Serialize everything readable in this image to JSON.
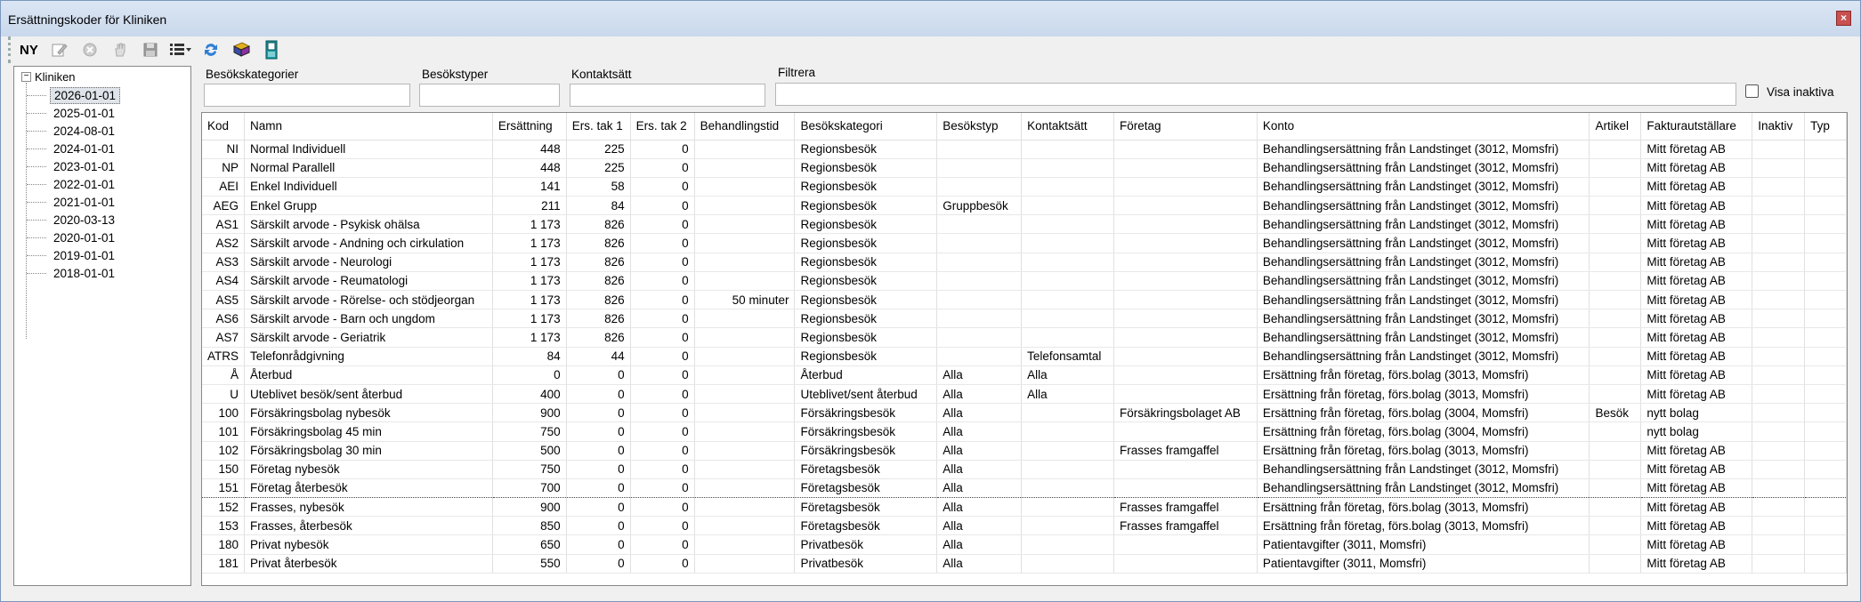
{
  "window": {
    "title": "Ersättningskoder för Kliniken",
    "close_label": "×"
  },
  "toolbar": {
    "new_label": "NY",
    "icons": [
      "edit-icon",
      "delete-icon",
      "hand-icon",
      "save-icon",
      "list-view-icon",
      "refresh-icon",
      "book-icon",
      "door-icon"
    ]
  },
  "tree": {
    "root": "Kliniken",
    "toggle": "−",
    "items": [
      "2026-01-01",
      "2025-01-01",
      "2024-08-01",
      "2024-01-01",
      "2023-01-01",
      "2022-01-01",
      "2021-01-01",
      "2020-03-13",
      "2020-01-01",
      "2019-01-01",
      "2018-01-01"
    ]
  },
  "filters": {
    "besokskategorier": "Besökskategorier",
    "besokstyper": "Besökstyper",
    "kontaktsatt": "Kontaktsätt",
    "filtrera": "Filtrera",
    "visa_inaktiva": "Visa inaktiva"
  },
  "columns": [
    "Kod",
    "Namn",
    "Ersättning",
    "Ers. tak 1",
    "Ers. tak 2",
    "Behandlingstid",
    "Besökskategori",
    "Besökstyp",
    "Kontaktsätt",
    "Företag",
    "Konto",
    "Artikel",
    "Fakturautställare",
    "Inaktiv",
    "Typ"
  ],
  "rows": [
    [
      "NI",
      "Normal Individuell",
      "448",
      "225",
      "0",
      "",
      "Regionsbesök",
      "",
      "",
      "",
      "Behandlingsersättning från Landstinget (3012, Momsfri)",
      "",
      "Mitt företag AB",
      "",
      ""
    ],
    [
      "NP",
      "Normal Parallell",
      "448",
      "225",
      "0",
      "",
      "Regionsbesök",
      "",
      "",
      "",
      "Behandlingsersättning från Landstinget (3012, Momsfri)",
      "",
      "Mitt företag AB",
      "",
      ""
    ],
    [
      "AEI",
      "Enkel Individuell",
      "141",
      "58",
      "0",
      "",
      "Regionsbesök",
      "",
      "",
      "",
      "Behandlingsersättning från Landstinget (3012, Momsfri)",
      "",
      "Mitt företag AB",
      "",
      ""
    ],
    [
      "AEG",
      "Enkel Grupp",
      "211",
      "84",
      "0",
      "",
      "Regionsbesök",
      "Gruppbesök",
      "",
      "",
      "Behandlingsersättning från Landstinget (3012, Momsfri)",
      "",
      "Mitt företag AB",
      "",
      ""
    ],
    [
      "AS1",
      "Särskilt arvode - Psykisk ohälsa",
      "1 173",
      "826",
      "0",
      "",
      "Regionsbesök",
      "",
      "",
      "",
      "Behandlingsersättning från Landstinget (3012, Momsfri)",
      "",
      "Mitt företag AB",
      "",
      ""
    ],
    [
      "AS2",
      "Särskilt arvode - Andning och cirkulation",
      "1 173",
      "826",
      "0",
      "",
      "Regionsbesök",
      "",
      "",
      "",
      "Behandlingsersättning från Landstinget (3012, Momsfri)",
      "",
      "Mitt företag AB",
      "",
      ""
    ],
    [
      "AS3",
      "Särskilt arvode - Neurologi",
      "1 173",
      "826",
      "0",
      "",
      "Regionsbesök",
      "",
      "",
      "",
      "Behandlingsersättning från Landstinget (3012, Momsfri)",
      "",
      "Mitt företag AB",
      "",
      ""
    ],
    [
      "AS4",
      "Särskilt arvode - Reumatologi",
      "1 173",
      "826",
      "0",
      "",
      "Regionsbesök",
      "",
      "",
      "",
      "Behandlingsersättning från Landstinget (3012, Momsfri)",
      "",
      "Mitt företag AB",
      "",
      ""
    ],
    [
      "AS5",
      "Särskilt arvode - Rörelse- och stödjeorgan",
      "1 173",
      "826",
      "0",
      "50 minuter",
      "Regionsbesök",
      "",
      "",
      "",
      "Behandlingsersättning från Landstinget (3012, Momsfri)",
      "",
      "Mitt företag AB",
      "",
      ""
    ],
    [
      "AS6",
      "Särskilt arvode - Barn och ungdom",
      "1 173",
      "826",
      "0",
      "",
      "Regionsbesök",
      "",
      "",
      "",
      "Behandlingsersättning från Landstinget (3012, Momsfri)",
      "",
      "Mitt företag AB",
      "",
      ""
    ],
    [
      "AS7",
      "Särskilt arvode - Geriatrik",
      "1 173",
      "826",
      "0",
      "",
      "Regionsbesök",
      "",
      "",
      "",
      "Behandlingsersättning från Landstinget (3012, Momsfri)",
      "",
      "Mitt företag AB",
      "",
      ""
    ],
    [
      "ATRS",
      "Telefonrådgivning",
      "84",
      "44",
      "0",
      "",
      "Regionsbesök",
      "",
      "Telefonsamtal",
      "",
      "Behandlingsersättning från Landstinget (3012, Momsfri)",
      "",
      "Mitt företag AB",
      "",
      ""
    ],
    [
      "Å",
      "Återbud",
      "0",
      "0",
      "0",
      "",
      "Återbud",
      "Alla",
      "Alla",
      "",
      "Ersättning från företag, förs.bolag (3013, Momsfri)",
      "",
      "Mitt företag AB",
      "",
      ""
    ],
    [
      "U",
      "Uteblivet besök/sent återbud",
      "400",
      "0",
      "0",
      "",
      "Uteblivet/sent återbud",
      "Alla",
      "Alla",
      "",
      "Ersättning från företag, förs.bolag (3013, Momsfri)",
      "",
      "Mitt företag AB",
      "",
      ""
    ],
    [
      "100",
      "Försäkringsbolag nybesök",
      "900",
      "0",
      "0",
      "",
      "Försäkringsbesök",
      "Alla",
      "",
      "Försäkringsbolaget AB",
      "Ersättning från företag, förs.bolag (3004, Momsfri)",
      "Besök",
      "nytt bolag",
      "",
      ""
    ],
    [
      "101",
      "Försäkringsbolag 45 min",
      "750",
      "0",
      "0",
      "",
      "Försäkringsbesök",
      "Alla",
      "",
      "",
      "Ersättning från företag, förs.bolag (3004, Momsfri)",
      "",
      "nytt bolag",
      "",
      ""
    ],
    [
      "102",
      "Försäkringsbolag 30 min",
      "500",
      "0",
      "0",
      "",
      "Försäkringsbesök",
      "Alla",
      "",
      "Frasses framgaffel",
      "Ersättning från företag, förs.bolag (3013, Momsfri)",
      "",
      "Mitt företag AB",
      "",
      ""
    ],
    [
      "150",
      "Företag nybesök",
      "750",
      "0",
      "0",
      "",
      "Företagsbesök",
      "Alla",
      "",
      "",
      "Behandlingsersättning från Landstinget (3012, Momsfri)",
      "",
      "Mitt företag AB",
      "",
      ""
    ],
    [
      "151",
      "Företag återbesök",
      "700",
      "0",
      "0",
      "",
      "Företagsbesök",
      "Alla",
      "",
      "",
      "Behandlingsersättning från Landstinget (3012, Momsfri)",
      "",
      "Mitt företag AB",
      "",
      ""
    ],
    [
      "152",
      "Frasses, nybesök",
      "900",
      "0",
      "0",
      "",
      "Företagsbesök",
      "Alla",
      "",
      "Frasses framgaffel",
      "Ersättning från företag, förs.bolag (3013, Momsfri)",
      "",
      "Mitt företag AB",
      "",
      ""
    ],
    [
      "153",
      "Frasses, återbesök",
      "850",
      "0",
      "0",
      "",
      "Företagsbesök",
      "Alla",
      "",
      "Frasses framgaffel",
      "Ersättning från företag, förs.bolag (3013, Momsfri)",
      "",
      "Mitt företag AB",
      "",
      ""
    ],
    [
      "180",
      "Privat nybesök",
      "650",
      "0",
      "0",
      "",
      "Privatbesök",
      "Alla",
      "",
      "",
      "Patientavgifter (3011, Momsfri)",
      "",
      "Mitt företag AB",
      "",
      ""
    ],
    [
      "181",
      "Privat återbesök",
      "550",
      "0",
      "0",
      "",
      "Privatbesök",
      "Alla",
      "",
      "",
      "Patientavgifter (3011, Momsfri)",
      "",
      "Mitt företag AB",
      "",
      ""
    ]
  ]
}
